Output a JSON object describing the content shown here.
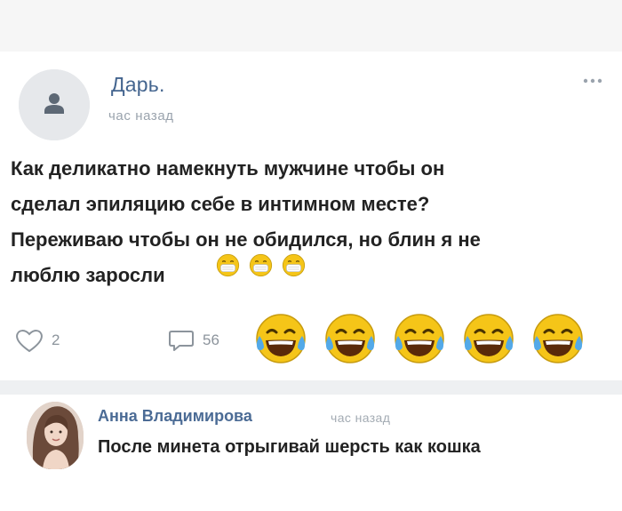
{
  "post": {
    "author_name": "Дарь.",
    "time": "час назад",
    "text": "Как деликатно намекнуть мужчине чтобы он\nсделал эпиляцию себе в интимном месте?\nПереживаю чтобы он не обидился, но блин я не\nлюблю заросли",
    "text_emojis": [
      "face-with-medical-mask-icon",
      "face-with-medical-mask-icon",
      "face-with-medical-mask-icon"
    ],
    "menu_icon": "more-dots-icon"
  },
  "actions": {
    "like_icon": "heart-icon",
    "likes": "2",
    "comment_icon": "comment-icon",
    "comments": "56",
    "reaction_icon": "face-with-tears-of-joy-icon",
    "reaction_count": 5
  },
  "comment": {
    "author_name": "Анна Владимирова",
    "time": "час назад",
    "text": "После минета отрыгивай шерсть как кошка"
  },
  "colors": {
    "link": "#44658f",
    "muted": "#9aa3ad",
    "emoji_yellow": "#f5c518",
    "tear_blue": "#53a9e8"
  }
}
